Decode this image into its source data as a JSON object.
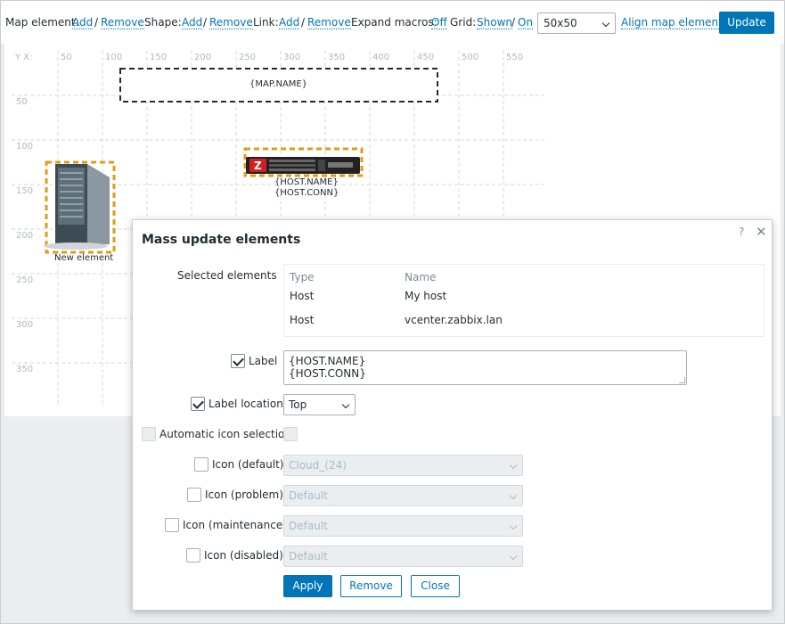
{
  "toolbar": {
    "map_element_label": "Map element:",
    "shape_label": "Shape:",
    "link_label": "Link:",
    "add": "Add",
    "remove": "Remove",
    "slash": "/",
    "expand_macros_label": "Expand macros:",
    "expand_macros_value": "Off",
    "grid_label": "Grid:",
    "grid_shown": "Shown",
    "grid_on": "On",
    "grid_size": "50x50",
    "align": "Align map elements",
    "update": "Update"
  },
  "map": {
    "axis_corner": "Y X:",
    "x_ticks": [
      "50",
      "100",
      "150",
      "200",
      "250",
      "300",
      "350",
      "400",
      "450",
      "500",
      "550"
    ],
    "y_ticks": [
      "50",
      "100",
      "150",
      "200",
      "250",
      "300",
      "350"
    ],
    "map_name_label": "{MAP.NAME}",
    "host_label_1": "{HOST.NAME}",
    "host_label_2": "{HOST.CONN}",
    "new_element_label": "New element"
  },
  "dialog": {
    "title": "Mass update elements",
    "help": "?",
    "close": "✕",
    "selected_elements_label": "Selected elements",
    "table": {
      "headers": [
        "Type",
        "Name"
      ],
      "rows": [
        [
          "Host",
          "My host"
        ],
        [
          "Host",
          "vcenter.zabbix.lan"
        ]
      ]
    },
    "label_field": "Label",
    "label_value_line1": "{HOST.NAME}",
    "label_value_line2": "{HOST.CONN}",
    "label_location_field": "Label location",
    "label_location_value": "Top",
    "auto_icon_field": "Automatic icon selection",
    "icon_default_field": "Icon (default)",
    "icon_default_value": "Cloud_(24)",
    "icon_problem_field": "Icon (problem)",
    "icon_problem_value": "Default",
    "icon_maintenance_field": "Icon (maintenance)",
    "icon_maintenance_value": "Default",
    "icon_disabled_field": "Icon (disabled)",
    "icon_disabled_value": "Default",
    "apply": "Apply",
    "remove": "Remove",
    "close_btn": "Close"
  }
}
